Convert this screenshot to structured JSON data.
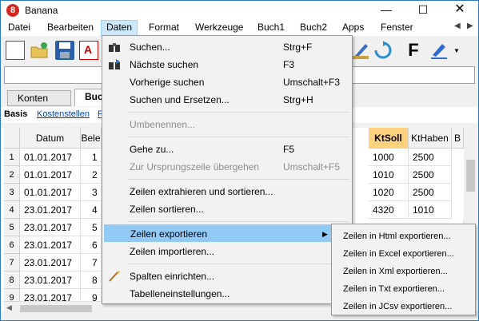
{
  "window": {
    "title": "Banana",
    "app_icon": "8",
    "min": "—",
    "max": "☐",
    "close": "✕"
  },
  "menubar": [
    "Datei",
    "Bearbeiten",
    "Daten",
    "Format",
    "Werkzeuge",
    "Buch1",
    "Buch2",
    "Apps",
    "Fenster"
  ],
  "toolbar": {
    "bold_label": "F"
  },
  "tabs": [
    "Konten",
    "Buc"
  ],
  "views": {
    "active": "Basis",
    "link1": "Kostenstellen",
    "link2": "F"
  },
  "grid": {
    "headers": [
      "Datum",
      "Bele",
      "KtSoll",
      "KtHaben",
      "B"
    ],
    "rows": [
      {
        "num": "1",
        "date": "01.01.2017",
        "beleg": "1",
        "ktsoll": "1000",
        "kthaben": "2500"
      },
      {
        "num": "2",
        "date": "01.01.2017",
        "beleg": "2",
        "ktsoll": "1010",
        "kthaben": "2500"
      },
      {
        "num": "3",
        "date": "01.01.2017",
        "beleg": "3",
        "ktsoll": "1020",
        "kthaben": "2500"
      },
      {
        "num": "4",
        "date": "23.01.2017",
        "beleg": "4",
        "ktsoll": "4320",
        "kthaben": "1010"
      },
      {
        "num": "5",
        "date": "23.01.2017",
        "beleg": "5",
        "ktsoll": "",
        "kthaben": ""
      },
      {
        "num": "6",
        "date": "23.01.2017",
        "beleg": "6",
        "ktsoll": "",
        "kthaben": ""
      },
      {
        "num": "7",
        "date": "23.01.2017",
        "beleg": "7",
        "ktsoll": "",
        "kthaben": ""
      },
      {
        "num": "8",
        "date": "23.01.2017",
        "beleg": "8",
        "ktsoll": "",
        "kthaben": ""
      },
      {
        "num": "9",
        "date": "23.01.2017",
        "beleg": "9",
        "ktsoll": "",
        "kthaben": ""
      }
    ]
  },
  "dropdown": {
    "items": [
      {
        "label": "Suchen...",
        "shortcut": "Strg+F"
      },
      {
        "label": "Nächste suchen",
        "shortcut": "F3"
      },
      {
        "label": "Vorherige suchen",
        "shortcut": "Umschalt+F3"
      },
      {
        "label": "Suchen und Ersetzen...",
        "shortcut": "Strg+H"
      },
      {
        "label": "Umbenennen...",
        "shortcut": ""
      },
      {
        "label": "Gehe zu...",
        "shortcut": "F5"
      },
      {
        "label": "Zur Ursprungszeile übergehen",
        "shortcut": "Umschalt+F5"
      },
      {
        "label": "Zeilen extrahieren und sortieren...",
        "shortcut": ""
      },
      {
        "label": "Zeilen sortieren...",
        "shortcut": ""
      },
      {
        "label": "Zeilen exportieren",
        "shortcut": ""
      },
      {
        "label": "Zeilen importieren...",
        "shortcut": ""
      },
      {
        "label": "Spalten einrichten...",
        "shortcut": ""
      },
      {
        "label": "Tabelleneinstellungen...",
        "shortcut": ""
      }
    ],
    "submenu_arrow": "▶"
  },
  "submenu": [
    "Zeilen in Html exportieren...",
    "Zeilen in Excel exportieren...",
    "Zeilen in Xml exportieren...",
    "Zeilen in Txt exportieren...",
    "Zeilen in JCsv exportieren..."
  ],
  "colors": {
    "accent": "#2b78c5",
    "highlight": "#91c9f7",
    "ktsoll_header": "#ffd27f",
    "menu_open": "#cce8ff"
  }
}
